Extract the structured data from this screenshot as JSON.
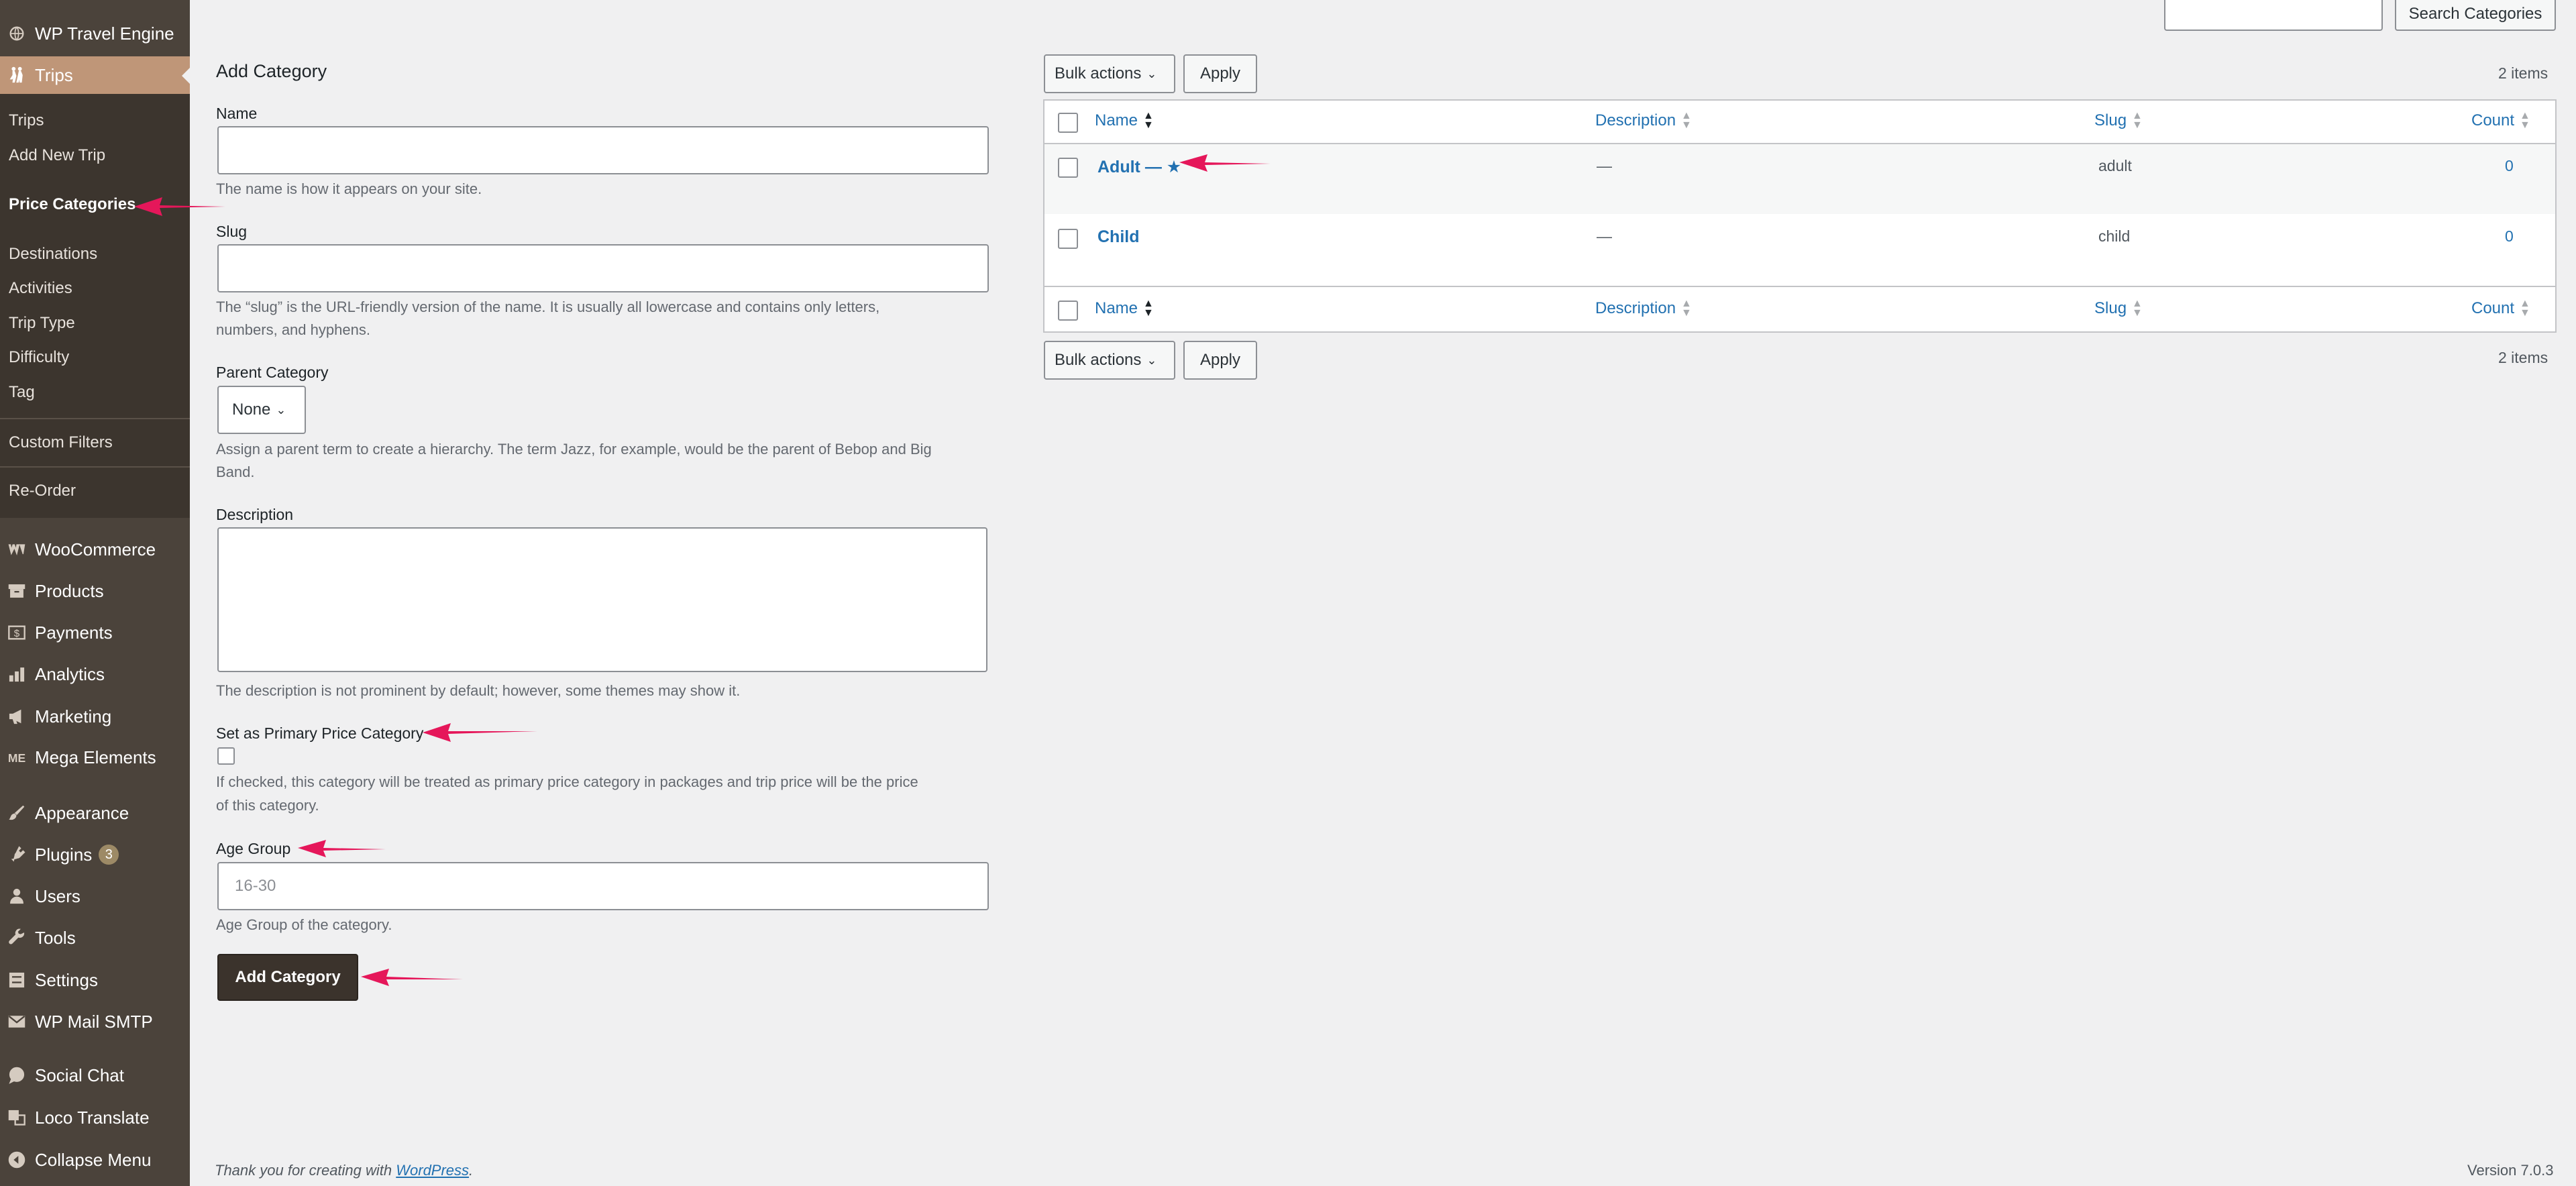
{
  "sidebar": {
    "plugin_title": "WP Travel Engine",
    "active_menu": "Trips",
    "submenu": [
      "Trips",
      "Add New Trip",
      "Price Categories",
      "Destinations",
      "Activities",
      "Trip Type",
      "Difficulty",
      "Tag",
      "Custom Filters",
      "Re-Order"
    ],
    "menu": [
      {
        "label": "WooCommerce",
        "icon": "woo-icon"
      },
      {
        "label": "Products",
        "icon": "archive-icon"
      },
      {
        "label": "Payments",
        "icon": "dollar-icon"
      },
      {
        "label": "Analytics",
        "icon": "bar-chart-icon"
      },
      {
        "label": "Marketing",
        "icon": "megaphone-icon"
      },
      {
        "label": "Mega Elements",
        "icon": "mega-elements-icon"
      },
      {
        "label": "Appearance",
        "icon": "paintbrush-icon"
      },
      {
        "label": "Plugins",
        "icon": "plug-icon",
        "badge": "3"
      },
      {
        "label": "Users",
        "icon": "users-icon"
      },
      {
        "label": "Tools",
        "icon": "wrench-icon"
      },
      {
        "label": "Settings",
        "icon": "sliders-icon"
      },
      {
        "label": "WP Mail SMTP",
        "icon": "mail-icon"
      },
      {
        "label": "Social Chat",
        "icon": "chat-icon"
      },
      {
        "label": "Loco Translate",
        "icon": "translate-icon"
      },
      {
        "label": "Collapse Menu",
        "icon": "collapse-icon"
      }
    ]
  },
  "search": {
    "input_value": "",
    "button_label": "Search Categories"
  },
  "form": {
    "heading": "Add Category",
    "name_label": "Name",
    "name_value": "",
    "name_help": "The name is how it appears on your site.",
    "slug_label": "Slug",
    "slug_value": "",
    "slug_help_1": "The “slug” is the URL-friendly version of the name. It is usually all lowercase and contains only letters,",
    "slug_help_2": "numbers, and hyphens.",
    "parent_label": "Parent Category",
    "parent_value": "None",
    "parent_help_1": "Assign a parent term to create a hierarchy. The term Jazz, for example, would be the parent of Bebop and Big",
    "parent_help_2": "Band.",
    "description_label": "Description",
    "description_value": "",
    "description_help": "The description is not prominent by default; however, some themes may show it.",
    "primary_label": "Set as Primary Price Category",
    "primary_checked": false,
    "primary_help_1": "If checked, this category will be treated as primary price category in packages and trip price will be the price",
    "primary_help_2": "of this category.",
    "age_label": "Age Group",
    "age_placeholder": "16-30",
    "age_help": "Age Group of the category.",
    "submit_label": "Add Category"
  },
  "list": {
    "bulk_label": "Bulk actions",
    "apply_label": "Apply",
    "item_count": "2 items",
    "columns": [
      "Name",
      "Description",
      "Slug",
      "Count"
    ],
    "rows": [
      {
        "name": "Adult — ★",
        "description": "—",
        "slug": "adult",
        "count": "0"
      },
      {
        "name": "Child",
        "description": "—",
        "slug": "child",
        "count": "0"
      }
    ]
  },
  "footer": {
    "thanks_prefix": "Thank you for creating with ",
    "thanks_link": "WordPress",
    "thanks_suffix": ".",
    "version": "Version 7.0.3"
  },
  "colors": {
    "sidebar_bg": "#4b433b",
    "submenu_bg": "#3c352e",
    "active_menu_bg": "#bf9678",
    "link": "#2271b1",
    "arrow": "#e5175a",
    "primary_button": "#3b332c"
  }
}
